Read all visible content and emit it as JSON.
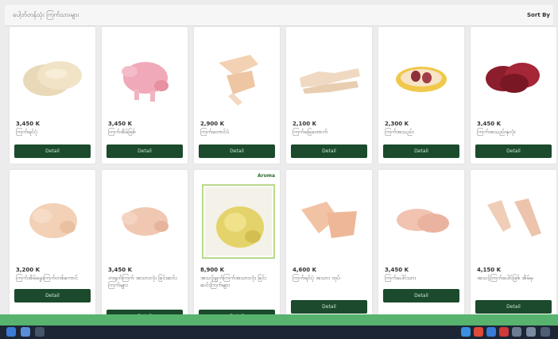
{
  "header": {
    "title": "ပေါ့ဘ်တန်သုံး ကြက်သားများ",
    "right_label": "Sort By"
  },
  "products": [
    {
      "price": "3,450 K",
      "name": "ကြက်ရင်ပုံ",
      "button": "Detail",
      "image": "chicken-breast"
    },
    {
      "price": "3,450 K",
      "name": "ကြက်အိမ်ဖြစ်",
      "button": "Detail",
      "image": "whole-chicken-pink"
    },
    {
      "price": "2,900 K",
      "name": "ကြက်တောင်ပံ",
      "button": "Detail",
      "image": "chicken-wings"
    },
    {
      "price": "2,100 K",
      "name": "ကြက်ခြေထောက်",
      "button": "Detail",
      "image": "chicken-feet"
    },
    {
      "price": "2,300 K",
      "name": "ကြက်အသည်း",
      "button": "Detail",
      "image": "chicken-gizzard"
    },
    {
      "price": "3,450 K",
      "name": "ကြက်အသည်းနှလုံး",
      "button": "Detail",
      "image": "chicken-liver"
    },
    {
      "price": "3,200 K",
      "name": "ကြက်အိမ်မွေးကြက်တစ်ကောင်",
      "button": "Detail",
      "image": "whole-chicken"
    },
    {
      "price": "3,450 K",
      "name": "တရုတ်ကြက် အသားလုံး ခြင်းဆင်းကြက်များ",
      "button": "Detail",
      "image": "whole-broiler"
    },
    {
      "price": "8,900 K",
      "name": "အသင့်ချက်ကြက်အသားလုံး ခြင်းဆင်းကြက်များ",
      "button": "Detail",
      "image": "whole-yellow-chicken",
      "badge": "Aroma"
    },
    {
      "price": "4,600 K",
      "name": "ကြက်ရင်ပုံ အသား ထုပ်",
      "button": "Detail",
      "image": "chicken-pieces"
    },
    {
      "price": "3,450 K",
      "name": "ကြက်ပေါင်သား",
      "button": "Detail",
      "image": "chicken-thigh"
    },
    {
      "price": "4,150 K",
      "name": "အသင့်ကြက်ပေါင်ဖြစ် အိမ်မှ",
      "button": "Detail",
      "image": "chicken-drumsticks"
    }
  ],
  "colors": {
    "button": "#1b4a2c",
    "accent_bar": "#57b36d",
    "taskbar": "#1c2635"
  }
}
